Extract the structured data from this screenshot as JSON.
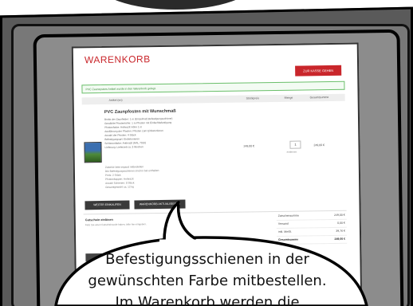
{
  "comic": {
    "panel_color": "#5a5a5a",
    "bubble_lines": [
      "Befestigungsschienen in der",
      "gewünschten Farbe mitbestellen.",
      "Im Warenkorb werden die"
    ]
  },
  "shop": {
    "brand": "WARENKORB",
    "brand_color": "#c9262b",
    "checkout_label": "ZUR KASSE GEHEN",
    "notice": "PVC Zaunsystem Artikel wurde in den Warenkorb gelegt.",
    "table_headers": {
      "article": "Artikel (en)",
      "unit_price": "Stückpreis",
      "quantity": "Menge",
      "total": "Gesamtsumme"
    },
    "product": {
      "title": "PVC Zaunpfosten mit Wunschmaß",
      "details": [
        "Breite der Zaunfelder: 1 m (Einzelmaß Befestigungsschiene)",
        "Gewählte Pfostenhöhe: 1 m Pfosten mit Einfachbefestigung",
        "Pfostenfarbe: Anthrazit Höhe 1 m",
        "Ausführung der Pfosten: Pfosten zum Einbetonieren",
        "Anzahl der Pfosten: 4 Stück",
        "Befestigungsart: Einbetonieren",
        "Schienenfarbe: Anthrazit (RAL 7016)",
        "Lieferung: Lieferzeit ca. 3 Wochen"
      ],
      "details_extra": [
        "Zubehör bitte separat mitbestellen",
        "Die Befestigungsschienen sind im Set enthalten",
        "Preis: 2 Stück",
        "Pfostenkappen: Anthrazit",
        "Anzahl Schienen: 8 Stück",
        "Gesamtgewicht ca. 12 kg"
      ],
      "unit_price": "249,00 €",
      "quantity": "1",
      "remove_label": "entfernen",
      "line_total": "249,00 €"
    },
    "buttons": {
      "continue": "WEITER EINKAUFEN",
      "update": "WARENKORB AKTUALISIEREN"
    },
    "coupon": {
      "title": "Gutschein einlösen",
      "subtitle": "Falls Sie einen Gutscheincode haben, bitte hier eingeben."
    },
    "summary": [
      {
        "label": "Zwischensumme",
        "value": "249,00 €"
      },
      {
        "label": "Versand",
        "value": "0,00 €"
      },
      {
        "label": "inkl. MwSt.",
        "value": "39,76 €"
      },
      {
        "label": "Gesamtsumme",
        "value": "249,00 €"
      }
    ]
  }
}
